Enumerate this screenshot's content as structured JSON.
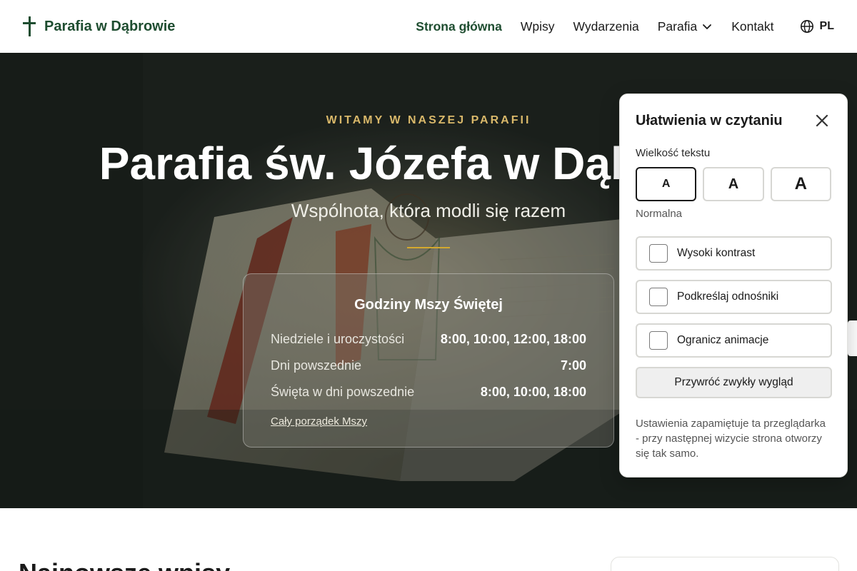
{
  "header": {
    "logo_text": "Parafia w Dąbrowie",
    "nav": [
      {
        "label": "Strona główna",
        "active": true
      },
      {
        "label": "Wpisy"
      },
      {
        "label": "Wydarzenia"
      },
      {
        "label": "Parafia",
        "has_dropdown": true
      },
      {
        "label": "Kontakt"
      }
    ],
    "language": "PL",
    "icons": {
      "logo": "cross-icon",
      "language": "globe-icon",
      "dropdown": "chevron-down-icon"
    }
  },
  "hero": {
    "eyebrow": "WITAMY W NASZEJ PARAFII",
    "title": "Parafia św. Józefa w Dąbrowie",
    "subtitle": "Wspólnota, która modli się razem",
    "mass_card": {
      "title": "Godziny Mszy Świętej",
      "rows": [
        {
          "label": "Niedziele i uroczystości",
          "times": "8:00, 10:00, 12:00, 18:00"
        },
        {
          "label": "Dni powszednie",
          "times": "7:00"
        },
        {
          "label": "Święta w dni powszednie",
          "times": "8:00, 10:00, 18:00"
        }
      ],
      "link": "Cały porządek Mszy"
    }
  },
  "accessibility_panel": {
    "title": "Ułatwienia w czytaniu",
    "text_size_label": "Wielkość tekstu",
    "size_options": [
      "A",
      "A",
      "A"
    ],
    "selected_size_index": 0,
    "selected_size_name": "Normalna",
    "options": [
      {
        "label": "Wysoki kontrast",
        "checked": false
      },
      {
        "label": "Podkreślaj odnośniki",
        "checked": false
      },
      {
        "label": "Ogranicz animacje",
        "checked": false
      }
    ],
    "reset_label": "Przywróć zwykły wygląd",
    "note": "Ustawienia zapamiętuje ta przeglądarka - przy następnej wizycie strona otworzy się tak samo.",
    "icons": {
      "close": "close-icon"
    }
  },
  "latest": {
    "heading": "Najnowsze wpisy"
  },
  "colors": {
    "brand_green": "#1e4d30",
    "gold": "#d4a92e",
    "eyebrow_gold": "#d9b86a"
  }
}
